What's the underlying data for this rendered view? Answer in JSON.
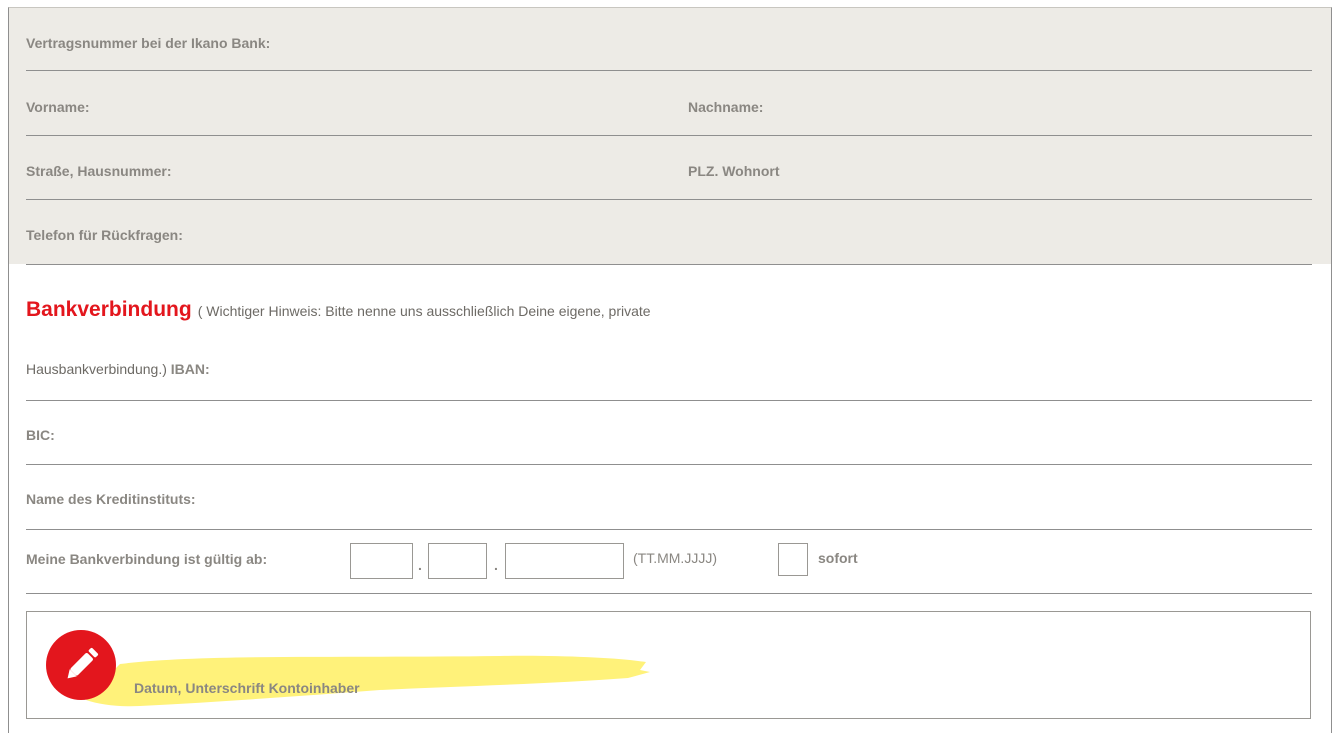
{
  "contract": {
    "contract_number_label": "Vertragsnummer bei der Ikano Bank:",
    "first_name_label": "Vorname:",
    "last_name_label": "Nachname:",
    "street_label": "Straße, Hausnummer:",
    "zip_city_label": "PLZ. Wohnort",
    "phone_label": "Telefon für Rückfragen:"
  },
  "bank": {
    "title": "Bankverbindung",
    "notice_part1": "( Wichtiger Hinweis: Bitte nenne uns ausschließlich Deine eigene, private",
    "notice_part2": "Hausbankverbindung.)",
    "iban_label": "IBAN:",
    "bic_label": "BIC:",
    "institute_label": "Name des Kreditinstituts:",
    "valid_from_label": "Meine Bankverbindung ist gültig ab:",
    "date_separator": ".",
    "date_format_hint": "(TT.MM.JJJJ)",
    "immediately_label": "sofort"
  },
  "signature": {
    "label": "Datum, Unterschrift Kontoinhaber",
    "icon": "pencil-icon"
  },
  "colors": {
    "accent_red": "#e3161d",
    "highlight_yellow": "#fff27a",
    "panel_gray": "#edebe6",
    "label_gray": "#8a8782"
  }
}
